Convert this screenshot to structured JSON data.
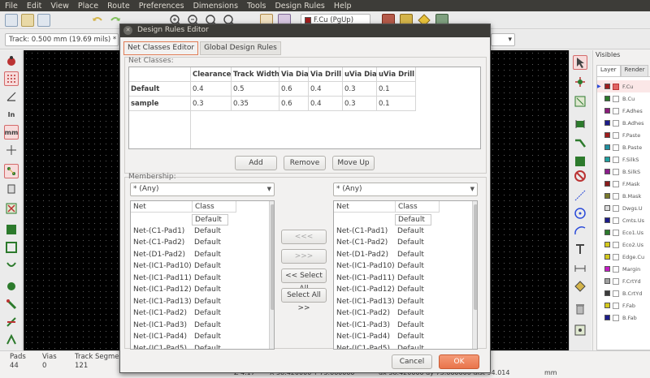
{
  "menubar": [
    "File",
    "Edit",
    "View",
    "Place",
    "Route",
    "Preferences",
    "Dimensions",
    "Tools",
    "Design Rules",
    "Help"
  ],
  "toolbar": {
    "layer_value": "F.Cu (PgUp)"
  },
  "toolbar2": {
    "track_value": "Track: 0.500 mm (19.69 mils) *"
  },
  "visibles": {
    "title": "Visibles",
    "tabs": [
      "Layer",
      "Render"
    ],
    "layers": [
      {
        "name": "F.Cu",
        "color": "#a01d1d",
        "checked": true,
        "active": true
      },
      {
        "name": "B.Cu",
        "color": "#2c7a2c",
        "checked": false
      },
      {
        "name": "F.Adhes",
        "color": "#8a1c7a",
        "checked": false
      },
      {
        "name": "B.Adhes",
        "color": "#1c1c8a",
        "checked": false
      },
      {
        "name": "F.Paste",
        "color": "#a01d1d",
        "checked": false
      },
      {
        "name": "B.Paste",
        "color": "#1f8fa0",
        "checked": false
      },
      {
        "name": "F.SilkS",
        "color": "#1fa0a0",
        "checked": false
      },
      {
        "name": "B.SilkS",
        "color": "#8a1c8a",
        "checked": false
      },
      {
        "name": "F.Mask",
        "color": "#8a1c1c",
        "checked": false
      },
      {
        "name": "B.Mask",
        "color": "#7a7a2c",
        "checked": false
      },
      {
        "name": "Dwgs.U",
        "color": "#dcdcdc",
        "checked": false
      },
      {
        "name": "Cmts.Us",
        "color": "#1c1c8a",
        "checked": false
      },
      {
        "name": "Eco1.Us",
        "color": "#2c7a2c",
        "checked": false
      },
      {
        "name": "Eco2.Us",
        "color": "#d4c91c",
        "checked": false
      },
      {
        "name": "Edge.Cu",
        "color": "#d4c91c",
        "checked": false
      },
      {
        "name": "Margin",
        "color": "#c41cc4",
        "checked": false
      },
      {
        "name": "F.CrtYd",
        "color": "#a0a0a0",
        "checked": false
      },
      {
        "name": "B.CrtYd",
        "color": "#3c3c3c",
        "checked": false
      },
      {
        "name": "F.Fab",
        "color": "#d4c91c",
        "checked": false
      },
      {
        "name": "B.Fab",
        "color": "#1c1c8a",
        "checked": false
      }
    ]
  },
  "status": {
    "pads_label": "Pads",
    "pads_value": "44",
    "vias_label": "Vias",
    "vias_value": "0",
    "track_label": "Track Segme",
    "track_value": "121",
    "zoom": "Z 4.17",
    "xy": "X 58.420000  Y 73.660000",
    "dxy": "dx 58.420000  dy 73.660000  dist 94.014",
    "units": "mm"
  },
  "dialog": {
    "title": "Design Rules Editor",
    "tabs": [
      "Net Classes Editor",
      "Global Design Rules"
    ],
    "net_classes_label": "Net Classes:",
    "columns": [
      "Clearance",
      "Track Width",
      "Via Dia",
      "Via Drill",
      "uVia Dia",
      "uVia Drill"
    ],
    "rows": [
      {
        "name": "Default",
        "values": [
          "0.4",
          "0.5",
          "0.6",
          "0.4",
          "0.3",
          "0.1"
        ]
      },
      {
        "name": "sample",
        "values": [
          "0.3",
          "0.35",
          "0.6",
          "0.4",
          "0.3",
          "0.1"
        ]
      }
    ],
    "add_label": "Add",
    "remove_label": "Remove",
    "moveup_label": "Move Up",
    "membership_label": "Membership:",
    "left_filter": "* (Any)",
    "right_filter": "* (Any)",
    "list_headers": [
      "Net",
      "Class"
    ],
    "nets": [
      {
        "net": "",
        "cls": "Default"
      },
      {
        "net": "Net-(C1-Pad1)",
        "cls": "Default"
      },
      {
        "net": "Net-(C1-Pad2)",
        "cls": "Default"
      },
      {
        "net": "Net-(D1-Pad2)",
        "cls": "Default"
      },
      {
        "net": "Net-(IC1-Pad10)",
        "cls": "Default"
      },
      {
        "net": "Net-(IC1-Pad11)",
        "cls": "Default"
      },
      {
        "net": "Net-(IC1-Pad12)",
        "cls": "Default"
      },
      {
        "net": "Net-(IC1-Pad13)",
        "cls": "Default"
      },
      {
        "net": "Net-(IC1-Pad2)",
        "cls": "Default"
      },
      {
        "net": "Net-(IC1-Pad3)",
        "cls": "Default"
      },
      {
        "net": "Net-(IC1-Pad4)",
        "cls": "Default"
      },
      {
        "net": "Net-(IC1-Pad5)",
        "cls": "Default"
      }
    ],
    "move_left_label": "<<<",
    "move_right_label": ">>>",
    "select_all_left_label": "<< Select All",
    "select_all_right_label": "Select All >>",
    "cancel_label": "Cancel",
    "ok_label": "OK"
  }
}
